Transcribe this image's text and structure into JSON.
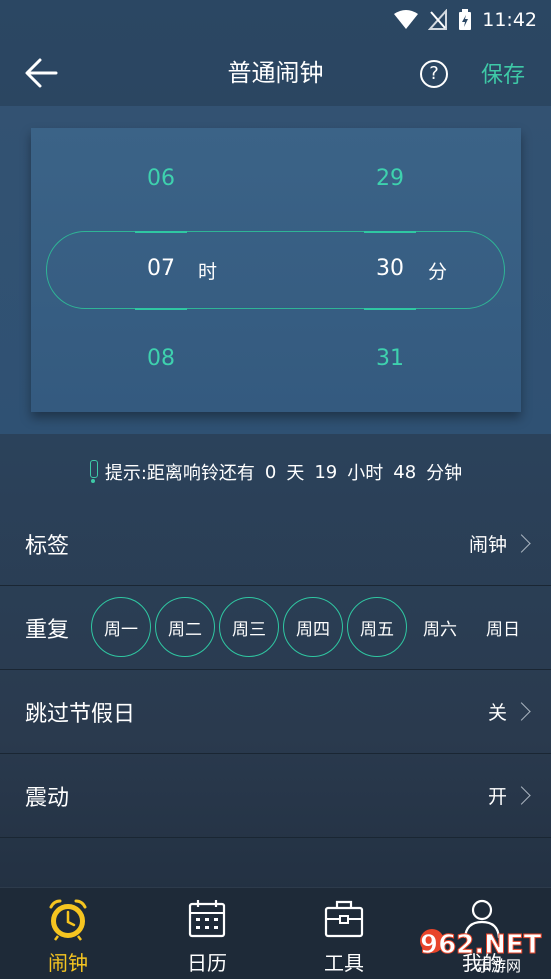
{
  "status_bar": {
    "time": "11:42"
  },
  "header": {
    "title": "普通闹钟",
    "help_label": "?",
    "save_label": "保存"
  },
  "picker": {
    "hours": {
      "prev": "06",
      "selected": "07",
      "next": "08",
      "unit": "时"
    },
    "minutes": {
      "prev": "29",
      "selected": "30",
      "next": "31",
      "unit": "分"
    }
  },
  "hint": {
    "prefix": "提示:距离响铃还有",
    "days": "0",
    "days_unit": "天",
    "hours": "19",
    "hours_unit": "小时",
    "minutes": "48",
    "minutes_unit": "分钟"
  },
  "settings": {
    "label": {
      "title": "标签",
      "value": "闹钟"
    },
    "repeat": {
      "title": "重复",
      "days": [
        {
          "label": "周一",
          "selected": true
        },
        {
          "label": "周二",
          "selected": true
        },
        {
          "label": "周三",
          "selected": true
        },
        {
          "label": "周四",
          "selected": true
        },
        {
          "label": "周五",
          "selected": true
        },
        {
          "label": "周六",
          "selected": false
        },
        {
          "label": "周日",
          "selected": false
        }
      ]
    },
    "skip_holidays": {
      "title": "跳过节假日",
      "value": "关"
    },
    "vibrate": {
      "title": "震动",
      "value": "开"
    }
  },
  "tabbar": {
    "tabs": [
      {
        "label": "闹钟",
        "icon": "alarm-clock-icon",
        "active": true
      },
      {
        "label": "日历",
        "icon": "calendar-icon",
        "active": false
      },
      {
        "label": "工具",
        "icon": "toolbox-icon",
        "active": false
      },
      {
        "label": "我的",
        "icon": "user-icon",
        "active": false
      }
    ]
  },
  "watermark": {
    "text": "962.NET",
    "subtext": "乐游网"
  },
  "colors": {
    "accent": "#3ec9a7",
    "active_tab": "#f6c520",
    "background": "#2b425b"
  }
}
